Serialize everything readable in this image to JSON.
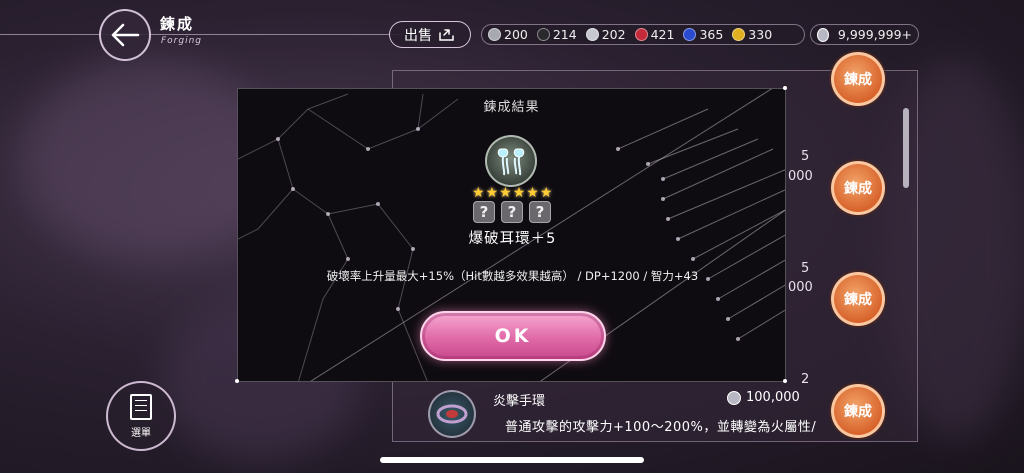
{
  "header": {
    "title": "鍊成",
    "subtitle": "Forging",
    "sell_label": "出售"
  },
  "resources": [
    {
      "name": "gray-gem",
      "value": "200",
      "color": "#a8a8b0"
    },
    {
      "name": "black-gem",
      "value": "214",
      "color": "#2a2a2e"
    },
    {
      "name": "silver-gem",
      "value": "202",
      "color": "#c8c8d0"
    },
    {
      "name": "red-gem",
      "value": "421",
      "color": "#c42a3a"
    },
    {
      "name": "blue-gem",
      "value": "365",
      "color": "#2a4ad0"
    },
    {
      "name": "gold-gem",
      "value": "330",
      "color": "#e0b020"
    }
  ],
  "currency": {
    "value": "9,999,999+"
  },
  "list": {
    "forge_label": "鍊成",
    "partial_values": {
      "row2_count": "5",
      "row2_cost": "000",
      "row3_count": "5",
      "row3_cost": "000",
      "row4_count": "2"
    },
    "visible_item": {
      "name": "炎擊手環",
      "cost": "100,000",
      "desc": "普通攻擊的攻擊力+100～200%，並轉變為火屬性/"
    }
  },
  "menu": {
    "label": "選單"
  },
  "dialog": {
    "title": "鍊成結果",
    "stars": 6,
    "unknown_slots": [
      "?",
      "?",
      "?"
    ],
    "item_name": "爆破耳環＋5",
    "effect": "破壞率上升量最大+15%（Hit數越多效果越高） / DP+1200 / 智力+43",
    "ok_label": "OK"
  },
  "colors": {
    "accent_pink": "#e06aa8",
    "forge_orange": "#d8642c",
    "star": "#ffcc33"
  }
}
